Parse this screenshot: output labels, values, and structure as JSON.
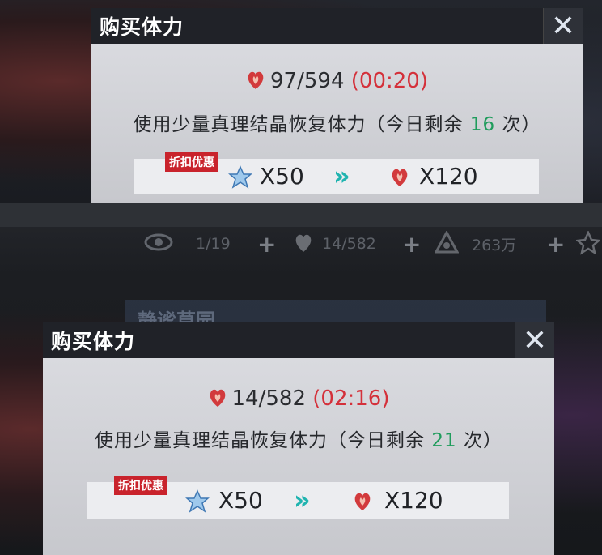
{
  "dialog_top": {
    "title": "购买体力",
    "stamina": "97/594",
    "timer": "(00:20)",
    "desc_prefix": "使用少量真理结晶恢复体力（今日剩余",
    "remaining": "16",
    "desc_suffix": "次）",
    "discount_badge": "折扣优惠",
    "cost": "X50",
    "gain": "X120"
  },
  "resource_bar": {
    "vision": "1/19",
    "stamina": "14/582",
    "coins": "263万"
  },
  "ghost_title": "静谧草园",
  "dialog_bottom": {
    "title": "购买体力",
    "stamina": "14/582",
    "timer": "(02:16)",
    "desc_prefix": "使用少量真理结晶恢复体力（今日剩余",
    "remaining": "21",
    "desc_suffix": "次）",
    "discount_badge": "折扣优惠",
    "cost": "X50",
    "gain": "X120"
  },
  "icons": {
    "close": "close-icon",
    "stamina": "heart-icon",
    "crystal": "crystal-icon",
    "arrow": "double-chevron-icon",
    "vision": "eye-icon",
    "coin": "coin-icon",
    "star": "star-icon"
  },
  "colors": {
    "timer": "#d4303a",
    "remaining": "#1f9c5c",
    "discount": "#c9232c",
    "arrow": "#20b4b0"
  }
}
